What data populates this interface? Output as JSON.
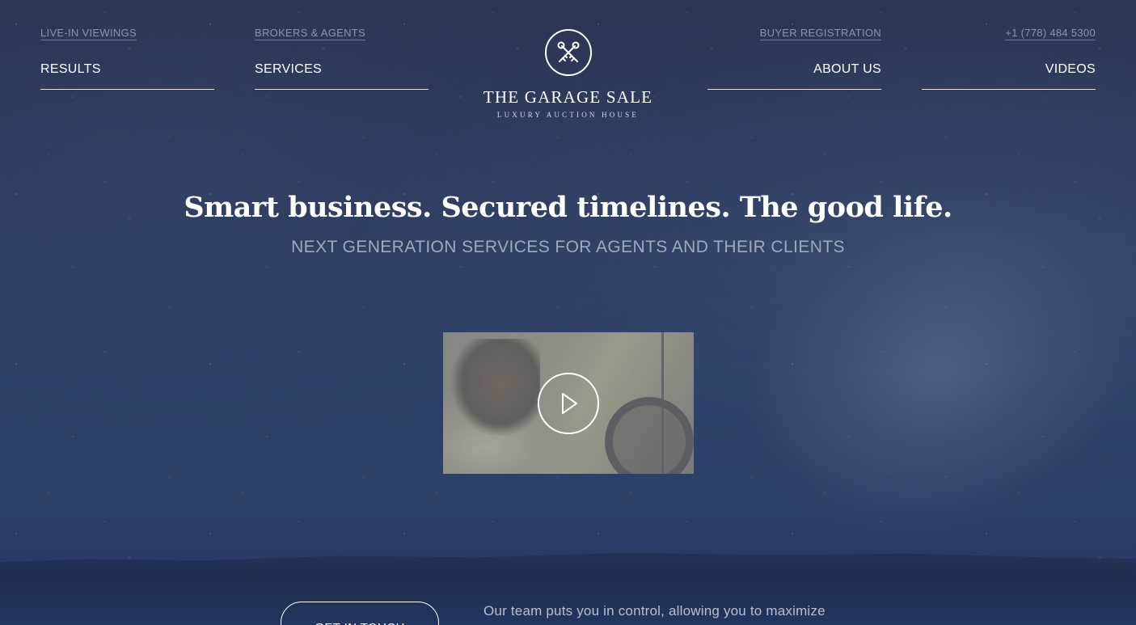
{
  "nav": {
    "left": [
      {
        "sub_label": "LIVE-IN VIEWINGS",
        "main_label": "RESULTS"
      },
      {
        "sub_label": "BROKERS & AGENTS",
        "main_label": "SERVICES"
      }
    ],
    "right": [
      {
        "sub_label": "BUYER REGISTRATION",
        "main_label": "ABOUT US"
      },
      {
        "sub_label": "+1 (778) 484 5300",
        "main_label": "VIDEOS"
      }
    ]
  },
  "logo": {
    "name": "THE GARAGE SALE",
    "tagline": "LUXURY AUCTION HOUSE",
    "icon": "crossed-keys-icon"
  },
  "hero": {
    "headline": "Smart business. Secured timelines. The good life.",
    "subheadline": "NEXT GENERATION SERVICES FOR AGENTS AND THEIR CLIENTS"
  },
  "video": {
    "icon": "play-icon"
  },
  "footer_cta": {
    "button_label": "GET IN TOUCH",
    "text": "Our team puts you in control, allowing you to maximize"
  },
  "colors": {
    "background": "#2a3a5e",
    "sub_link": "#8a95ad",
    "subheadline": "#9fa9c0"
  }
}
